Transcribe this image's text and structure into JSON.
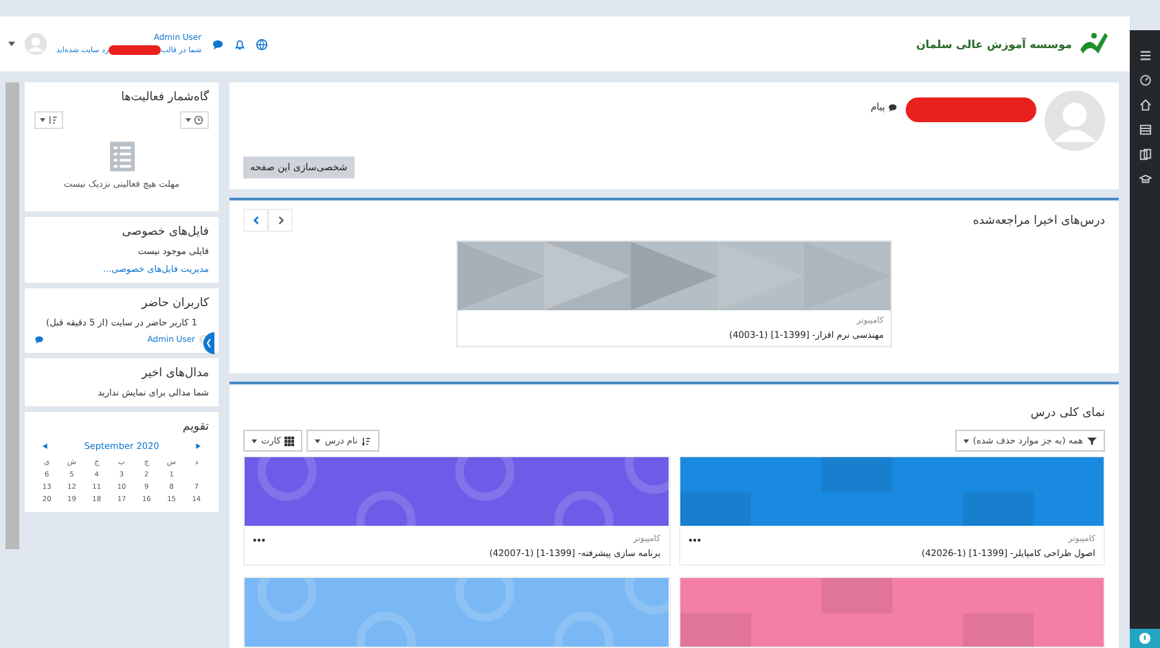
{
  "navbar": {
    "site_name": "موسسه آموزش عالی سلمان",
    "user_name": "Admin User",
    "login_note_start": "شما در قالب",
    "login_note_end": "رد سایت شده‌اید"
  },
  "timeline": {
    "title": "گاه‌شمار فعالیت‌ها",
    "empty": "مهلت هیچ فعالیتی نزدیک نیست"
  },
  "private_files": {
    "title": "فایل‌های خصوصی",
    "empty": "فایلی موجود نیست",
    "link": "مدیریت فایل‌های خصوصی..."
  },
  "online_users": {
    "title": "کاربران حاضر",
    "summary": "1 کاربر حاضر در سایت (از 5 دقیقه قبل)",
    "user": "Admin User"
  },
  "recent_badges": {
    "title": "مدال‌های اخیر",
    "empty": "شما مدالی برای نمایش ندارید"
  },
  "calendar": {
    "title": "تقویم",
    "month": "September 2020",
    "weekdays": [
      "د",
      "س",
      "چ",
      "پ",
      "ج",
      "ش",
      "ی"
    ],
    "weeks": [
      [
        "1",
        "2",
        "3",
        "4",
        "5",
        "6"
      ],
      [
        "7",
        "8",
        "9",
        "10",
        "11",
        "12",
        "13"
      ],
      [
        "14",
        "15",
        "16",
        "17",
        "18",
        "19",
        "20"
      ]
    ]
  },
  "profile": {
    "message_link": "پیام",
    "customize_button": "شخصی‌سازی این صفحه"
  },
  "recent_courses": {
    "title": "درس‌های اخیرا مراجعه‌شده",
    "courses": [
      {
        "category": "کامپیوتر",
        "name": "مهندسی نرم افزار- [1399-1] (1-4003)"
      }
    ]
  },
  "course_overview": {
    "title": "نمای کلی درس",
    "filter": "همه (به جز موارد حذف شده)",
    "sort": "نام درس",
    "view": "کارت",
    "courses": [
      {
        "color": "#1a8ae0",
        "category": "کامپیوتر",
        "name": "اصول طراحی کامپایلر- [1399-1] (1-42026)"
      },
      {
        "color": "#6c5ce7",
        "category": "کامپیوتر",
        "name": "برنامه سازی پیشرفته- [1399-1] (1-42007)"
      },
      {
        "color": "#f47fa6"
      },
      {
        "color": "#79b8f4"
      }
    ]
  }
}
